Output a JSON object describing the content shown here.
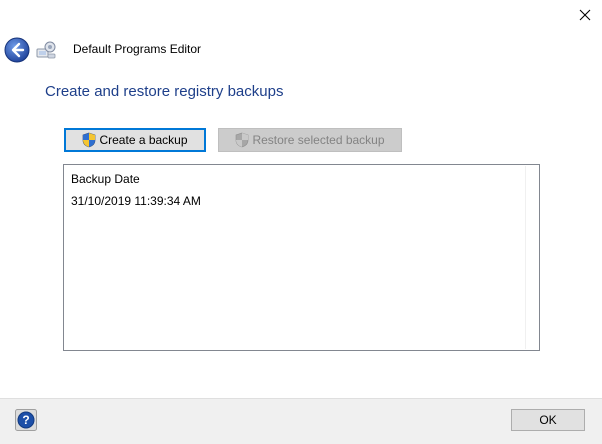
{
  "window": {
    "title": "Default Programs Editor",
    "close_icon": "close-icon"
  },
  "nav": {
    "back_icon": "back-arrow-icon",
    "app_icon": "default-programs-editor-icon"
  },
  "page": {
    "heading": "Create and restore registry backups"
  },
  "toolbar": {
    "create_label": "Create a backup",
    "restore_label": "Restore selected backup",
    "shield_icon": "uac-shield-icon"
  },
  "list": {
    "header": "Backup Date",
    "items": [
      {
        "date": "31/10/2019 11:39:34 AM"
      }
    ]
  },
  "footer": {
    "help_icon": "help-icon",
    "ok_label": "OK"
  },
  "colors": {
    "heading": "#1e3f8a",
    "focus_border": "#0078d7",
    "footer_bg": "#f0f0f0",
    "disabled_text": "#838383"
  }
}
